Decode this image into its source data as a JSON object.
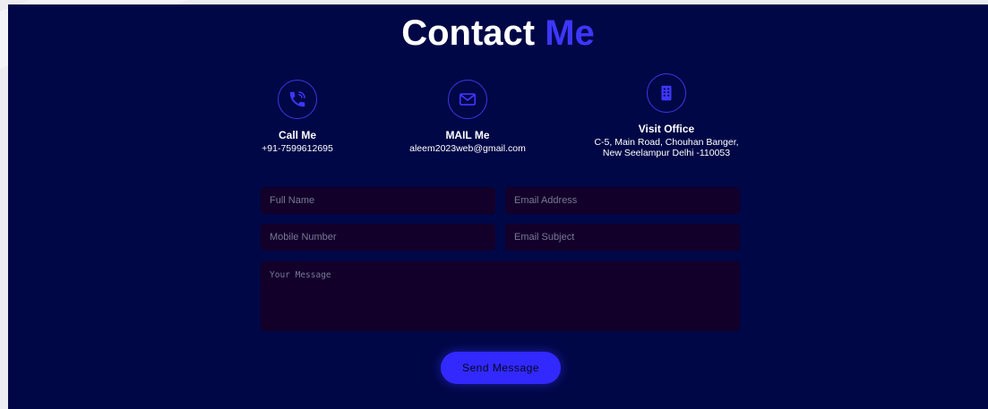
{
  "header": {
    "title_main": "Contact",
    "title_accent": "Me"
  },
  "contact_info": [
    {
      "icon": "phone-icon",
      "heading": "Call Me",
      "detail": "+91-7599612695"
    },
    {
      "icon": "mail-icon",
      "heading": "MAIL Me",
      "detail": "aleem2023web@gmail.com"
    },
    {
      "icon": "building-icon",
      "heading": "Visit Office",
      "detail": "C-5, Main Road, Chouhan Banger,\nNew Seelampur Delhi -110053"
    }
  ],
  "form": {
    "full_name_placeholder": "Full Name",
    "email_placeholder": "Email Address",
    "mobile_placeholder": "Mobile Number",
    "subject_placeholder": "Email Subject",
    "message_placeholder": "Your Message",
    "send_label": "Send Message"
  },
  "colors": {
    "background": "#000746",
    "accent": "#3d37ff",
    "field_bg": "#12002a"
  }
}
